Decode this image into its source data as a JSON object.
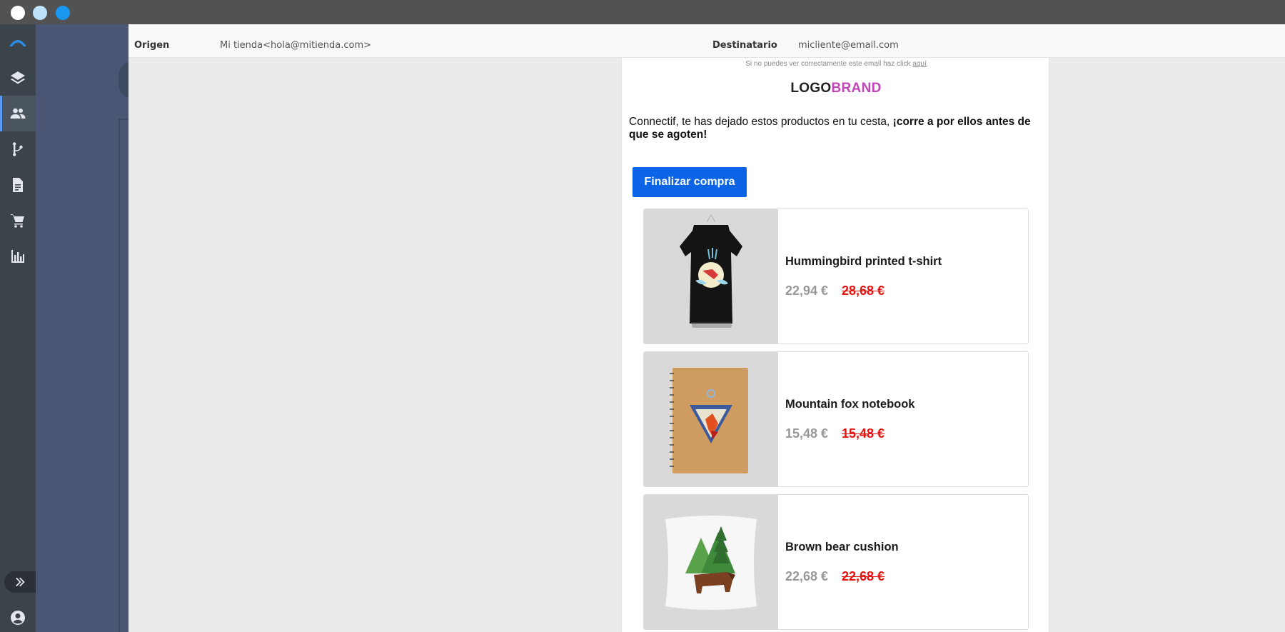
{
  "header": {
    "from_label": "Origen",
    "from_value": "Mi tienda<hola@mitienda.com>",
    "to_label": "Destinatario",
    "to_value": "micliente@email.com"
  },
  "email": {
    "preheader_text": "Si no puedes ver correctamente este email haz click",
    "preheader_link": "aquí",
    "brand_logo": "LOGO",
    "brand_name": "BRAND",
    "intro_text": "Connectif, te has dejado estos productos en tu cesta, ",
    "intro_bold": "¡corre a por ellos antes de que se agoten!",
    "cta_label": "Finalizar compra",
    "products": [
      {
        "name": "Hummingbird printed t-shirt",
        "price": "22,94 €",
        "old_price": "28,68 €"
      },
      {
        "name": "Mountain fox notebook",
        "price": "15,48 €",
        "old_price": "15,48 €"
      },
      {
        "name": "Brown bear cushion",
        "price": "22,68 €",
        "old_price": "22,68 €"
      }
    ]
  },
  "colors": {
    "accent": "#0b63e6",
    "brand": "#c046b8",
    "strike_price": "#e3140f",
    "sidebar": "#3b434b"
  },
  "sidebar": {
    "icons": [
      "connectif-logo-icon",
      "layers-icon",
      "contacts-icon",
      "workflow-icon",
      "document-icon",
      "cart-icon",
      "bar-chart-icon",
      "expand-icon",
      "account-icon"
    ]
  }
}
